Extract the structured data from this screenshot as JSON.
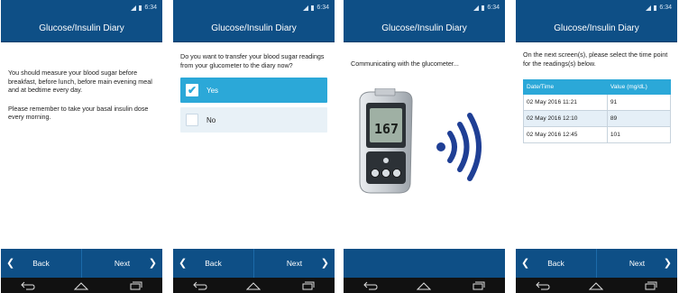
{
  "app_title": "Glucose/Insulin Diary",
  "status_time": "6:34",
  "nav": {
    "back_label": "Back",
    "next_label": "Next"
  },
  "screen1": {
    "paragraph1": "You should measure your blood sugar before breakfast, before lunch, before main evening meal and at bedtime every day.",
    "paragraph2": "Please remember to take your basal insulin dose every morning."
  },
  "screen2": {
    "question": "Do you want to transfer your blood sugar readings from your glucometer to the diary now?",
    "options": [
      {
        "label": "Yes",
        "checked": true
      },
      {
        "label": "No",
        "checked": false
      }
    ]
  },
  "screen3": {
    "status_text": "Communicating with the glucometer...",
    "meter_display": "167"
  },
  "screen4": {
    "instruction": "On the next screen(s), please select the time point for the readings(s) below.",
    "table": {
      "headers": [
        "Date/Time",
        "Value (mg/dL)"
      ],
      "rows": [
        {
          "datetime": "02 May 2016 11:21",
          "value": "91"
        },
        {
          "datetime": "02 May 2016 12:10",
          "value": "89"
        },
        {
          "datetime": "02 May 2016 12:45",
          "value": "101"
        }
      ]
    }
  },
  "colors": {
    "primary": "#0e4f86",
    "accent": "#2ba8d8",
    "light": "#e8f1f7"
  },
  "icons": {
    "nav_back": "chevron-left-icon",
    "nav_next": "chevron-right-icon",
    "sys_back": "back-arrow-icon",
    "sys_home": "home-icon",
    "sys_recent": "recent-apps-icon"
  }
}
